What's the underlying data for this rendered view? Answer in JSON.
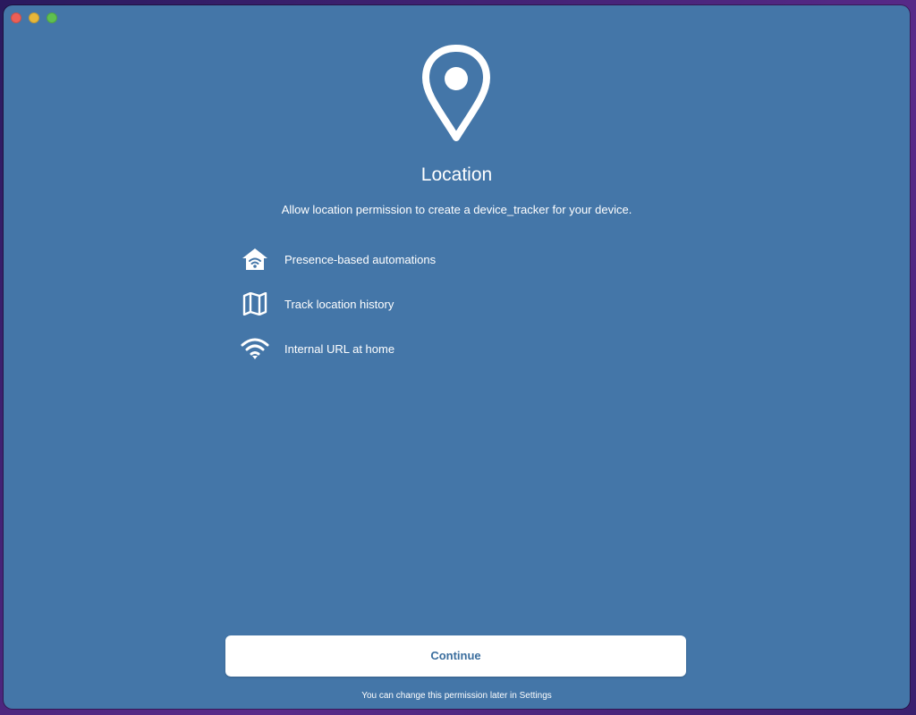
{
  "window": {
    "traffic_lights": [
      "close",
      "minimize",
      "zoom"
    ]
  },
  "hero": {
    "icon": "map-pin-icon",
    "title": "Location",
    "subtitle": "Allow location permission to create a device_tracker for your device."
  },
  "features": [
    {
      "icon": "home-wifi-icon",
      "label": "Presence-based automations"
    },
    {
      "icon": "map-icon",
      "label": "Track location history"
    },
    {
      "icon": "wifi-icon",
      "label": "Internal URL at home"
    }
  ],
  "actions": {
    "continue_label": "Continue"
  },
  "footer": {
    "note": "You can change this permission later in Settings"
  },
  "colors": {
    "background": "#4476a8",
    "button_text": "#3b6e9e",
    "text": "#ffffff"
  }
}
